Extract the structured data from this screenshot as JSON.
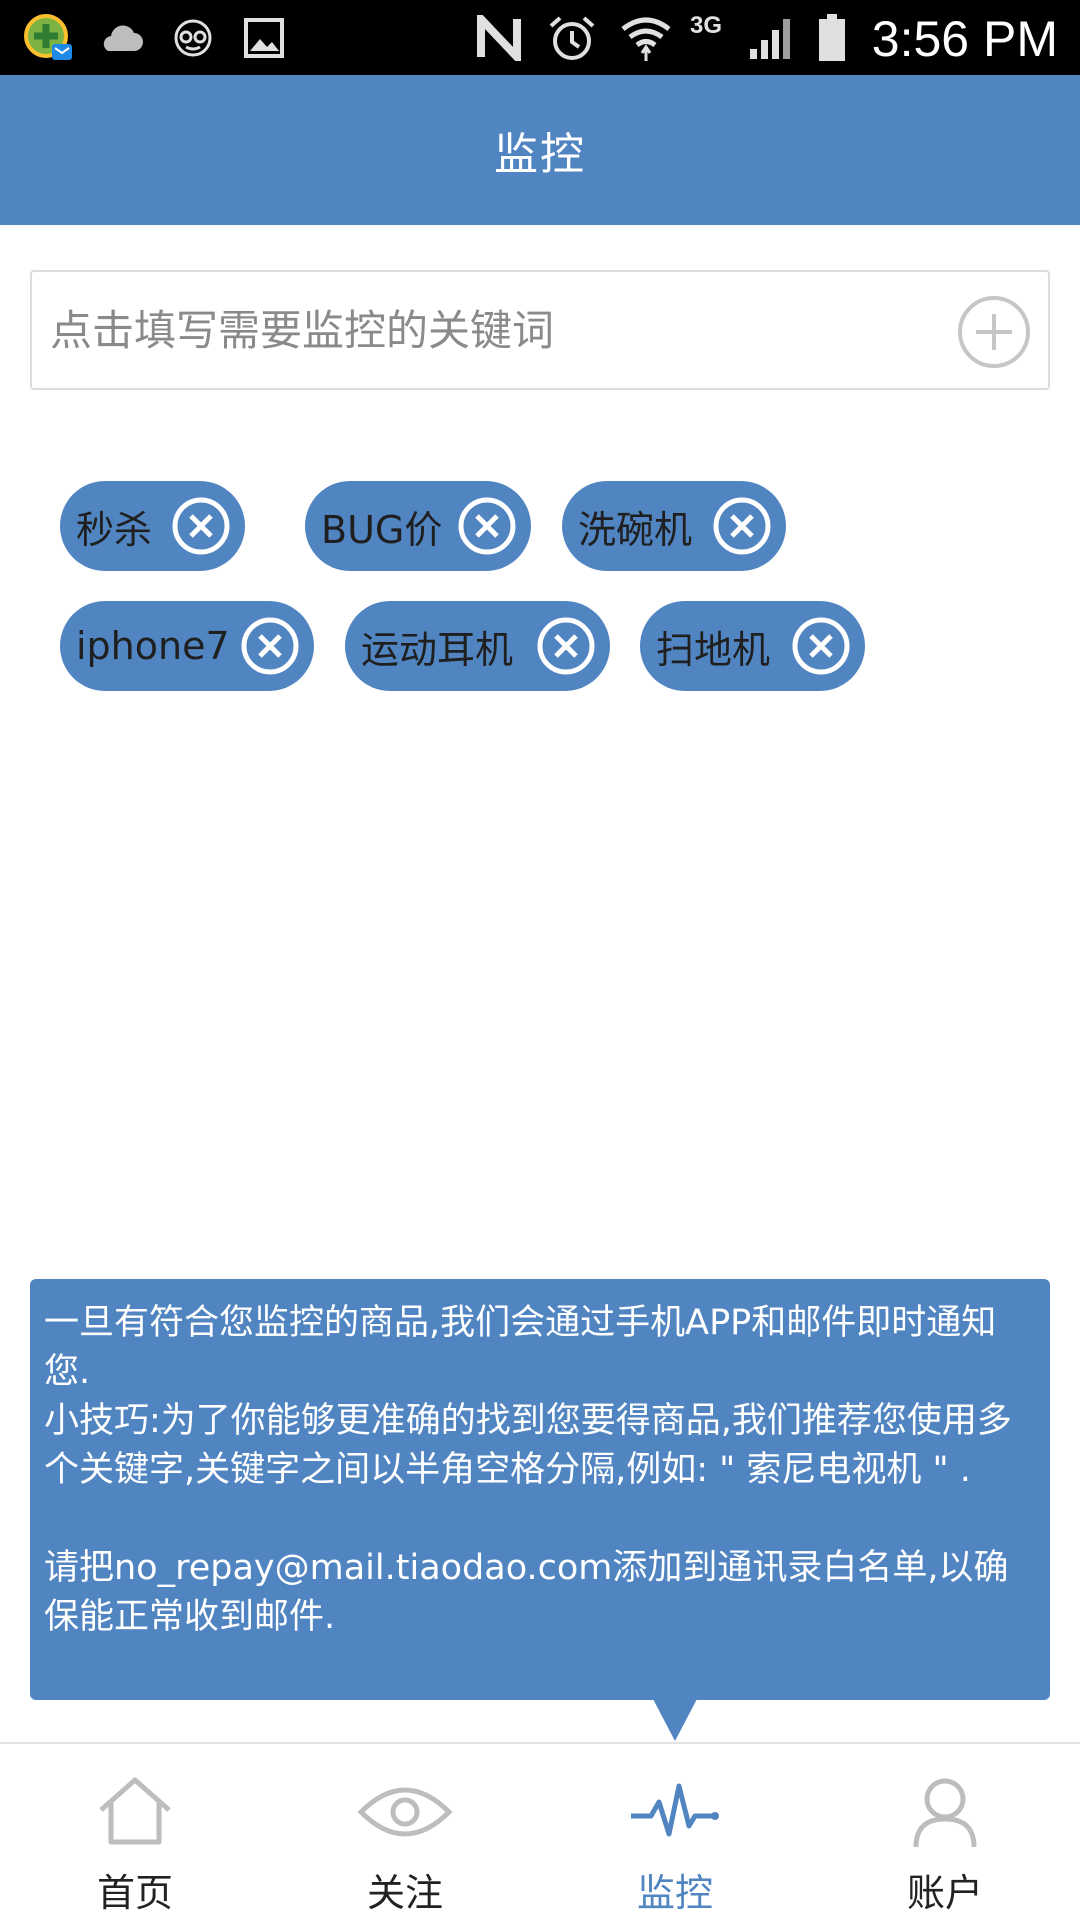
{
  "status_bar": {
    "time": "3:56 PM",
    "network": "3G",
    "icons": [
      "app-notification-icon",
      "cloud-icon",
      "glasses-icon",
      "image-icon",
      "nfc-icon",
      "alarm-icon",
      "wifi-icon",
      "signal-icon",
      "battery-icon"
    ]
  },
  "header": {
    "title": "监控"
  },
  "search": {
    "placeholder": "点击填写需要监控的关键词",
    "value": ""
  },
  "keywords": [
    {
      "label": "秒杀"
    },
    {
      "label": "BUG价"
    },
    {
      "label": "洗碗机"
    },
    {
      "label": "iphone7"
    },
    {
      "label": "运动耳机"
    },
    {
      "label": "扫地机"
    }
  ],
  "notice": {
    "line1": "一旦有符合您监控的商品,我们会通过手机APP和邮件即时通知您.",
    "line2": "小技巧:为了你能够更准确的找到您要得商品,我们推荐您使用多个关键字,关键字之间以半角空格分隔,例如: \" 索尼电视机 \" .",
    "line3": "请把no_repay@mail.tiaodao.com添加到通讯录白名单,以确保能正常收到邮件."
  },
  "bottom_nav": {
    "items": [
      {
        "label": "首页",
        "icon": "home-icon",
        "active": false
      },
      {
        "label": "关注",
        "icon": "eye-icon",
        "active": false
      },
      {
        "label": "监控",
        "icon": "pulse-icon",
        "active": true
      },
      {
        "label": "账户",
        "icon": "user-icon",
        "active": false
      }
    ]
  },
  "colors": {
    "primary": "#5085c2",
    "status_bar": "#000000",
    "background": "#ffffff"
  }
}
